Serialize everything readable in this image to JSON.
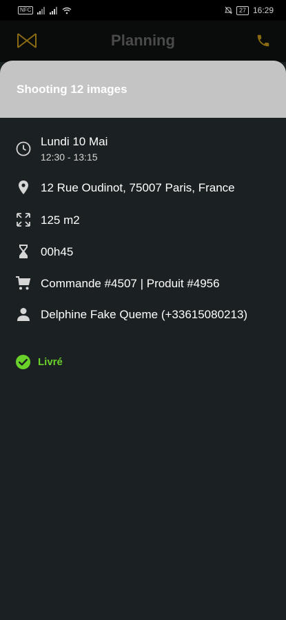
{
  "status_bar": {
    "left_chip": "NFC",
    "time": "16:29",
    "battery": "27"
  },
  "app_bar": {
    "title": "Planning",
    "logo_icon": "logo-icon",
    "action_icon": "phone-icon",
    "accent_color": "#8a6a12"
  },
  "sheet": {
    "title": "Shooting 12 images",
    "header_color": "#c4c4c4",
    "details": {
      "date": "Lundi 10 Mai",
      "time_range": "12:30 - 13:15",
      "address": "12 Rue Oudinot, 75007 Paris, France",
      "surface": "125 m2",
      "duration": "00h45",
      "order": "Commande #4507 |  Produit #4956",
      "contact": "Delphine Fake Queme (+33615080213)"
    },
    "icons": [
      "clock-icon",
      "location-pin-icon",
      "expand-icon",
      "hourglass-icon",
      "cart-icon",
      "person-icon"
    ],
    "status": {
      "label": "Livré",
      "icon": "check-circle-icon",
      "color": "#6ad12a"
    }
  }
}
